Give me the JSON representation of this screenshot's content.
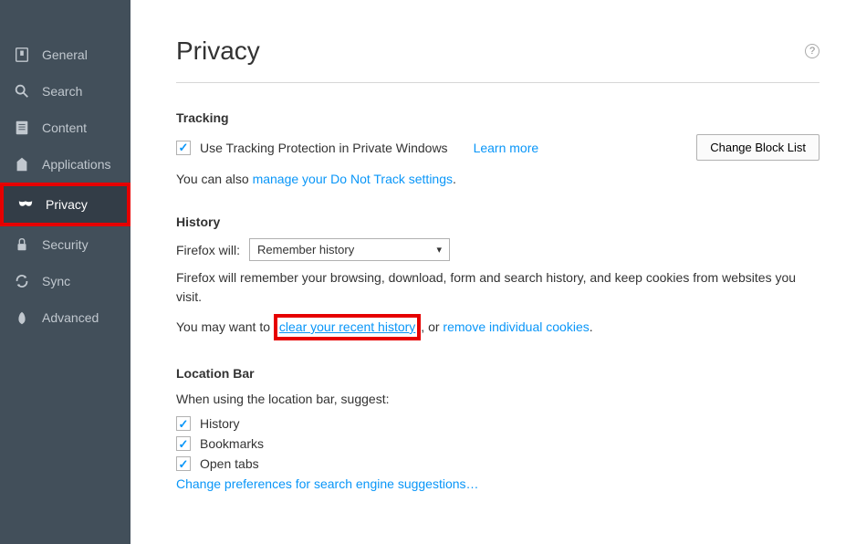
{
  "sidebar": {
    "items": [
      {
        "label": "General"
      },
      {
        "label": "Search"
      },
      {
        "label": "Content"
      },
      {
        "label": "Applications"
      },
      {
        "label": "Privacy"
      },
      {
        "label": "Security"
      },
      {
        "label": "Sync"
      },
      {
        "label": "Advanced"
      }
    ]
  },
  "page": {
    "title": "Privacy",
    "help": "?"
  },
  "tracking": {
    "title": "Tracking",
    "checkbox_label": "Use Tracking Protection in Private Windows",
    "learn_more": "Learn more",
    "block_list_btn": "Change Block List",
    "dnt_prefix": "You can also ",
    "dnt_link": "manage your Do Not Track settings",
    "dnt_suffix": "."
  },
  "history": {
    "title": "History",
    "firefox_will": "Firefox will:",
    "select_value": "Remember history",
    "remember_text": "Firefox will remember your browsing, download, form and search history, and keep cookies from websites you visit.",
    "may_want_prefix": "You may want to ",
    "clear_link": "clear your recent history",
    "between": ", or ",
    "remove_link": "remove individual cookies",
    "suffix": "."
  },
  "location_bar": {
    "title": "Location Bar",
    "suggest_text": "When using the location bar, suggest:",
    "history": "History",
    "bookmarks": "Bookmarks",
    "open_tabs": "Open tabs",
    "change_prefs": "Change preferences for search engine suggestions…"
  }
}
